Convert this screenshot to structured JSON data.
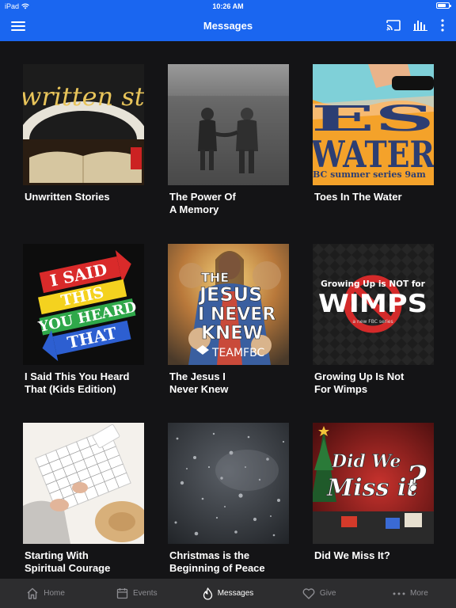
{
  "status_bar": {
    "device": "iPad",
    "time": "10:26 AM"
  },
  "header": {
    "title": "Messages",
    "background": "#1a66f0"
  },
  "cards": [
    {
      "title": "Unwritten Stories",
      "thumb_text": "written sto"
    },
    {
      "title": "The Power Of\nA Memory",
      "thumb_text": ""
    },
    {
      "title": "Toes In The Water",
      "thumb_text": "ES WATER",
      "thumb_subtext": "BC summer series  9am"
    },
    {
      "title": "I Said This You Heard\nThat (Kids Edition)",
      "thumb_lines": [
        "I SAID",
        "THIS",
        "YOU HEARD",
        "THAT"
      ]
    },
    {
      "title": "The Jesus I\nNever Knew",
      "thumb_lines": [
        "THE",
        "JESUS",
        "I NEVER",
        "KNEW"
      ],
      "thumb_subtext": "TEAMFBC"
    },
    {
      "title": "Growing Up Is Not\nFor Wimps",
      "thumb_lines": [
        "Growing Up is NOT for",
        "WIMPS"
      ],
      "thumb_subtext": "a new FBC series"
    },
    {
      "title": "Starting With\nSpiritual Courage",
      "thumb_text": ""
    },
    {
      "title": "Christmas is the\nBeginning of Peace",
      "thumb_text": ""
    },
    {
      "title": "Did We Miss It?",
      "thumb_lines": [
        "Did We",
        "Miss it",
        "?"
      ]
    }
  ],
  "tabs": [
    {
      "label": "Home",
      "icon": "home-icon",
      "active": false
    },
    {
      "label": "Events",
      "icon": "calendar-icon",
      "active": false
    },
    {
      "label": "Messages",
      "icon": "flame-icon",
      "active": true
    },
    {
      "label": "Give",
      "icon": "heart-icon",
      "active": false
    },
    {
      "label": "More",
      "icon": "ellipsis-icon",
      "active": false
    }
  ]
}
